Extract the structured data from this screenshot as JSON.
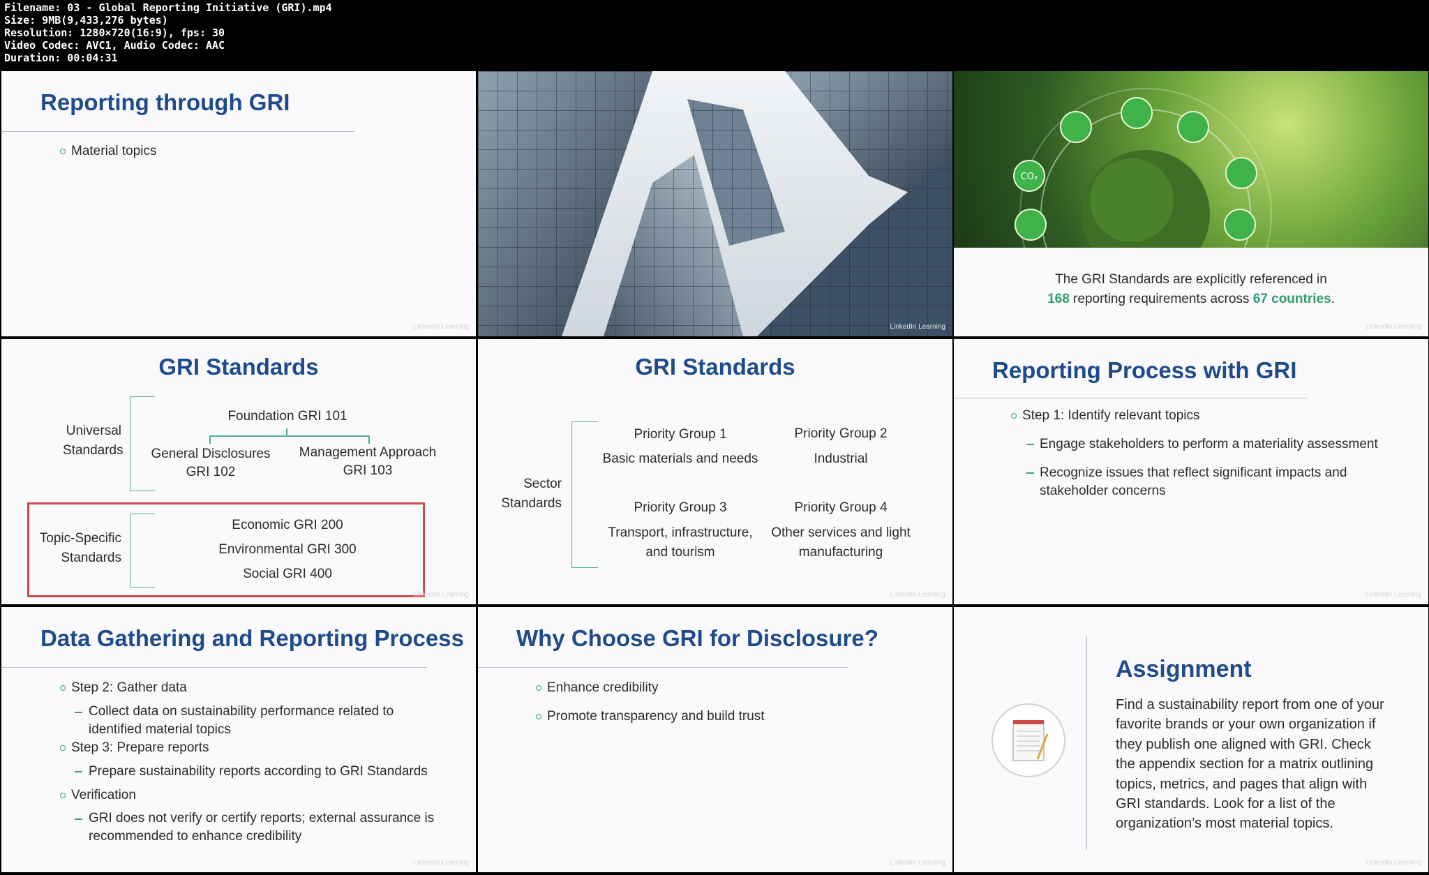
{
  "file_info": [
    "Filename: 03 - Global Reporting Initiative (GRI).mp4",
    "Size: 9MB(9,433,276 bytes)",
    "Resolution: 1280×720(16:9), fps: 30",
    "Video Codec: AVC1, Audio Codec: AAC",
    "Duration: 00:04:31"
  ],
  "watermark": "LinkedIn Learning",
  "slides": {
    "reporting_through_gri": {
      "title": "Reporting through GRI",
      "bullets": [
        "Material topics"
      ]
    },
    "globe": {
      "line1": "The GRI Standards are explicitly referenced in",
      "count_requirements": "168",
      "line2_mid": " reporting requirements across ",
      "count_countries": "67 countries",
      "line2_end": "."
    },
    "gri_standards_1": {
      "title": "GRI Standards",
      "universal_label_1": "Universal",
      "universal_label_2": "Standards",
      "foundation": "Foundation GRI 101",
      "general_1": "General Disclosures",
      "general_2": "GRI 102",
      "mgmt_1": "Management Approach",
      "mgmt_2": "GRI 103",
      "topic_label_1": "Topic-Specific",
      "topic_label_2": "Standards",
      "economic": "Economic GRI 200",
      "environmental": "Environmental GRI 300",
      "social": "Social GRI 400"
    },
    "gri_standards_2": {
      "title": "GRI Standards",
      "sector_label_1": "Sector",
      "sector_label_2": "Standards",
      "pg1_title": "Priority Group 1",
      "pg1_desc": "Basic materials and needs",
      "pg2_title": "Priority Group 2",
      "pg2_desc": "Industrial",
      "pg3_title": "Priority Group 3",
      "pg3_desc_1": "Transport, infrastructure,",
      "pg3_desc_2": "and tourism",
      "pg4_title": "Priority Group 4",
      "pg4_desc_1": "Other services and light",
      "pg4_desc_2": "manufacturing"
    },
    "reporting_process": {
      "title": "Reporting Process with GRI",
      "step1": "Step 1: Identify relevant topics",
      "sub1": "Engage stakeholders to perform a materiality assessment",
      "sub2_1": "Recognize issues that reflect significant impacts and",
      "sub2_2": "stakeholder concerns"
    },
    "data_gathering": {
      "title": "Data Gathering and Reporting Process",
      "step2": "Step 2: Gather data",
      "step2_sub_1": "Collect data on sustainability performance related to",
      "step2_sub_2": "identified material topics",
      "step3": "Step 3: Prepare reports",
      "step3_sub": "Prepare sustainability reports according to GRI Standards",
      "verification": "Verification",
      "verification_sub_1": "GRI does not verify or certify reports; external assurance is",
      "verification_sub_2": "recommended to enhance credibility"
    },
    "why_choose": {
      "title": "Why Choose GRI for Disclosure?",
      "bullets": [
        "Enhance credibility",
        "Promote transparency and build trust"
      ]
    },
    "assignment": {
      "title": "Assignment",
      "lines": [
        "Find a sustainability report from one of your",
        "favorite brands or your own organization if",
        "they publish one aligned with GRI. Check",
        "the appendix section for a matrix outlining",
        "topics, metrics, and pages that align with",
        "GRI standards. Look for a list of the",
        "organization’s most material topics."
      ]
    }
  },
  "colors": {
    "title_navy": "#1f4a8c",
    "accent_green": "#2e9e6b",
    "highlight_red": "#d04a4a"
  }
}
